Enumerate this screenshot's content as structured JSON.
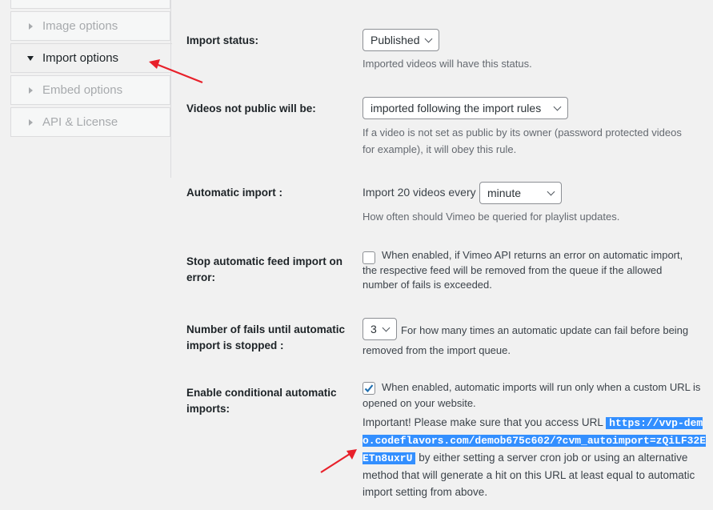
{
  "sidebar": {
    "items": [
      {
        "label": "Image options",
        "active": false
      },
      {
        "label": "Import options",
        "active": true
      },
      {
        "label": "Embed options",
        "active": false
      },
      {
        "label": "API & License",
        "active": false
      }
    ]
  },
  "rows": {
    "import_status": {
      "label": "Import status:",
      "value": "Published",
      "description": "Imported videos will have this status."
    },
    "not_public": {
      "label": "Videos not public will be:",
      "value": "imported following the import rules",
      "description": "If a video is not set as public by its owner (password protected videos for example), it will obey this rule."
    },
    "auto_import": {
      "label": "Automatic import :",
      "prefix": "Import 20 videos every",
      "value": "minute",
      "description": "How often should Vimeo be queried for playlist updates."
    },
    "stop_on_error": {
      "label": "Stop automatic feed import on error:",
      "checked": false,
      "description": "When enabled, if Vimeo API returns an error on automatic import, the respective feed will be removed from the queue if the allowed number of fails is exceeded."
    },
    "fails": {
      "label": "Number of fails until automatic import is stopped :",
      "value": "3",
      "description": "For how many times an automatic update can fail before being removed from the import queue."
    },
    "conditional": {
      "label": "Enable conditional automatic imports:",
      "checked": true,
      "description": "When enabled, automatic imports will run only when a custom URL is opened on your website.",
      "important_prefix": "Important! Please make sure that you access URL",
      "url": "https://vvp-demo.codeflavors.com/demob675c602/?cvm_autoimport=zQiLF32EETn8uxrU",
      "important_suffix": "by either setting a server cron job or using an alternative method that will generate a hit on this URL at least equal to automatic import setting from above."
    }
  },
  "colors": {
    "annotation_arrow": "#e8202a",
    "selection": "#338fff",
    "checkbox_check": "#2271b1"
  }
}
